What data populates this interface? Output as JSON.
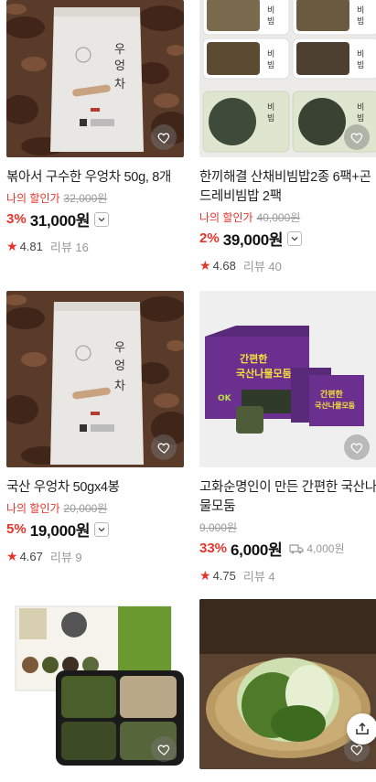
{
  "products": [
    {
      "title": "볶아서 구수한 우엉차 50g, 8개",
      "promo_label": "나의 할인가",
      "original_price": "32,000원",
      "discount_rate": "3%",
      "price": "31,000원",
      "rating": "4.81",
      "reviews": "리뷰 16",
      "image": "burdock-tea-pouch"
    },
    {
      "title": "한끼해결 산채비빔밥2종 6팩+곤드레비빔밥 2팩",
      "promo_label": "나의 할인가",
      "original_price": "40,000원",
      "discount_rate": "2%",
      "price": "39,000원",
      "rating": "4.68",
      "reviews": "리뷰 40",
      "image": "bibimbap-trays"
    },
    {
      "title": "국산 우엉차 50gx4봉",
      "promo_label": "나의 할인가",
      "original_price": "20,000원",
      "discount_rate": "5%",
      "price": "19,000원",
      "rating": "4.67",
      "reviews": "리뷰 9",
      "image": "burdock-tea-pouch"
    },
    {
      "title": "고화순명인이 만든 간편한 국산나물모둠",
      "original_price": "9,000원",
      "discount_rate": "33%",
      "price": "6,000원",
      "shipping": "4,000원",
      "rating": "4.75",
      "reviews": "리뷰 4",
      "image": "namul-box"
    },
    {
      "title": "",
      "image": "banchan-tray"
    },
    {
      "title": "",
      "image": "cabbage-basket"
    }
  ],
  "colors": {
    "accent": "#e8332b",
    "muted": "#999999"
  }
}
